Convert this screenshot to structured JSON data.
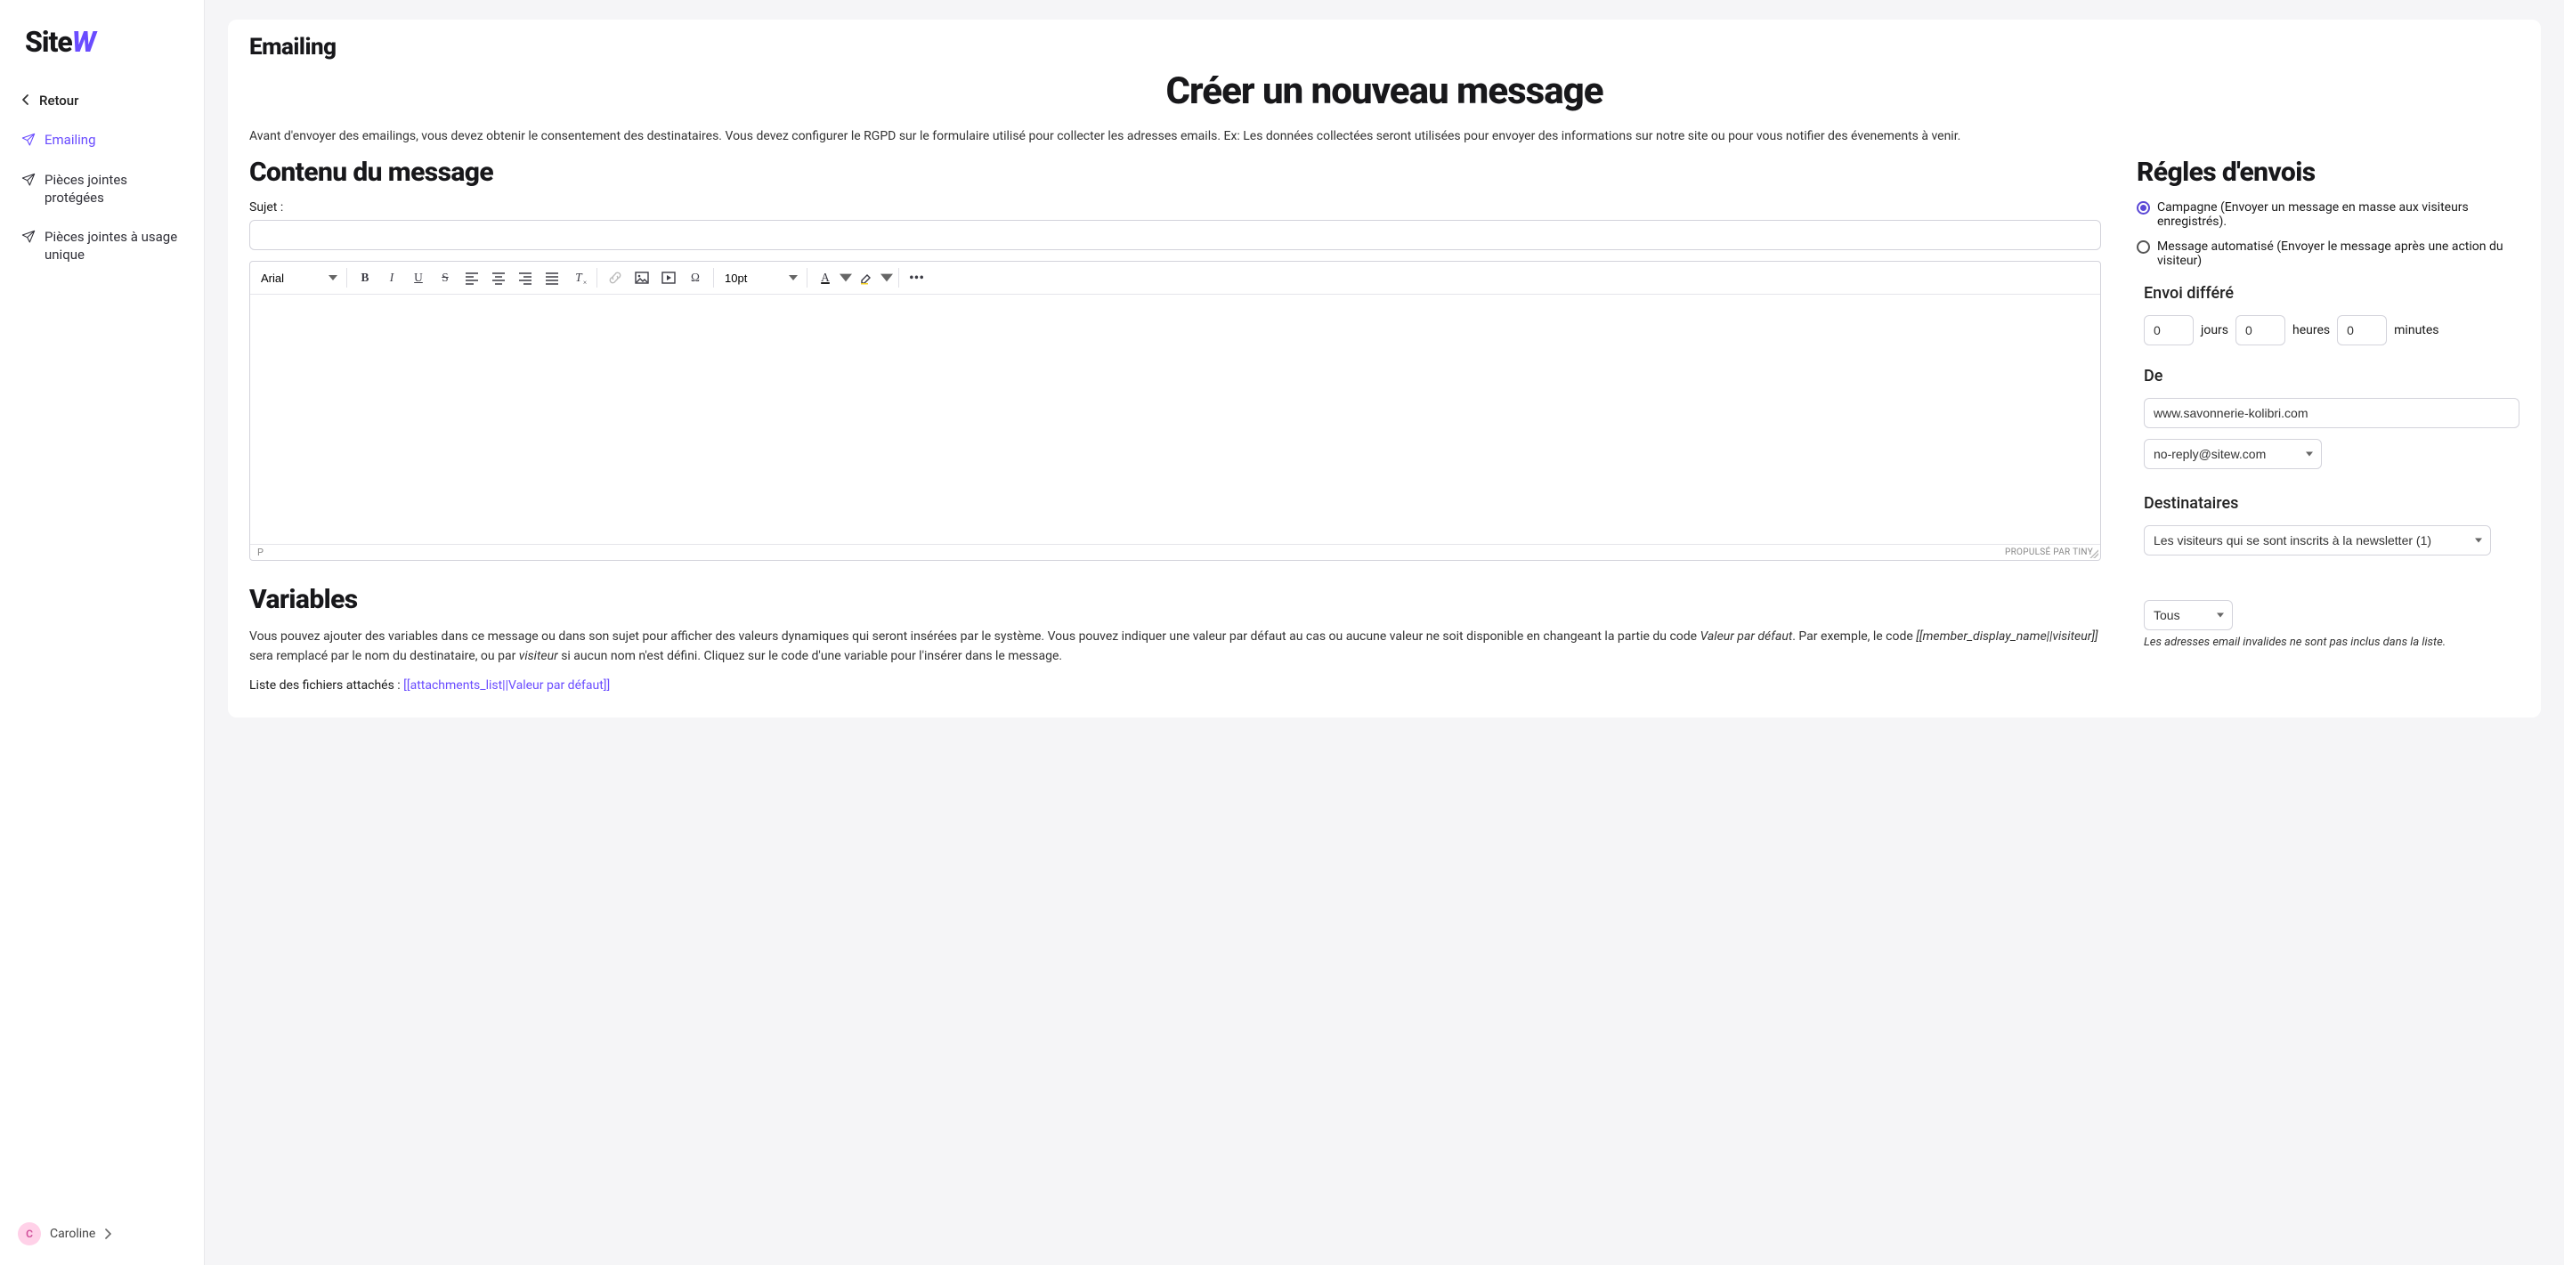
{
  "brand": {
    "name_part1": "Site",
    "name_part2": "W"
  },
  "nav": {
    "back": "Retour",
    "items": [
      {
        "label": "Emailing",
        "active": true
      },
      {
        "label": "Pièces jointes protégées",
        "active": false
      },
      {
        "label": "Pièces jointes à usage unique",
        "active": false
      }
    ]
  },
  "user": {
    "initial": "C",
    "name": "Caroline"
  },
  "page": {
    "breadcrumb": "Emailing",
    "title": "Créer un nouveau message",
    "intro": "Avant d'envoyer des emailings, vous devez obtenir le consentement des destinataires. Vous devez configurer le RGPD sur le formulaire utilisé pour collecter les adresses emails. Ex: Les données collectées seront utilisées pour envoyer des informations sur notre site ou pour vous notifier des évenements à venir."
  },
  "content_section": {
    "heading": "Contenu du message",
    "subject_label": "Sujet :",
    "subject_value": ""
  },
  "editor": {
    "font_family": "Arial",
    "font_size": "10pt",
    "status_path": "P",
    "credit": "PROPULSÉ PAR TINY"
  },
  "variables": {
    "heading": "Variables",
    "desc_part1": "Vous pouvez ajouter des variables dans ce message ou dans son sujet pour afficher des valeurs dynamiques qui seront insérées par le système. Vous pouvez indiquer une valeur par défaut au cas ou aucune valeur ne soit disponible en changeant la partie du code ",
    "desc_em1": "Valeur par défaut",
    "desc_part2": ". Par exemple, le code ",
    "desc_code": "[[member_display_name||visiteur]]",
    "desc_part3": " sera remplacé par le nom du destinataire, ou par ",
    "desc_em2": "visiteur",
    "desc_part4": " si aucun nom n'est défini. Cliquez sur le code d'une variable pour l'insérer dans le message.",
    "attach_label": "Liste des fichiers attachés : ",
    "attach_code": "[[attachments_list||Valeur par défaut]]"
  },
  "rules": {
    "heading": "Régles d'envois",
    "option_campaign": "Campagne (Envoyer un message en masse aux visiteurs enregistrés).",
    "option_auto": "Message automatisé (Envoyer le message après une action du visiteur)",
    "delay_heading": "Envoi différé",
    "delay_days_value": "0",
    "delay_days_label": "jours",
    "delay_hours_value": "0",
    "delay_hours_label": "heures",
    "delay_minutes_value": "0",
    "delay_minutes_label": "minutes",
    "from_heading": "De",
    "from_name": "www.savonnerie-kolibri.com",
    "from_email": "no-reply@sitew.com",
    "recipients_heading": "Destinataires",
    "recipients_value": "Les visiteurs qui se sont inscrits à la newsletter (1)",
    "filter_value": "Tous",
    "note": "Les adresses email invalides ne sont pas inclus dans la liste."
  }
}
